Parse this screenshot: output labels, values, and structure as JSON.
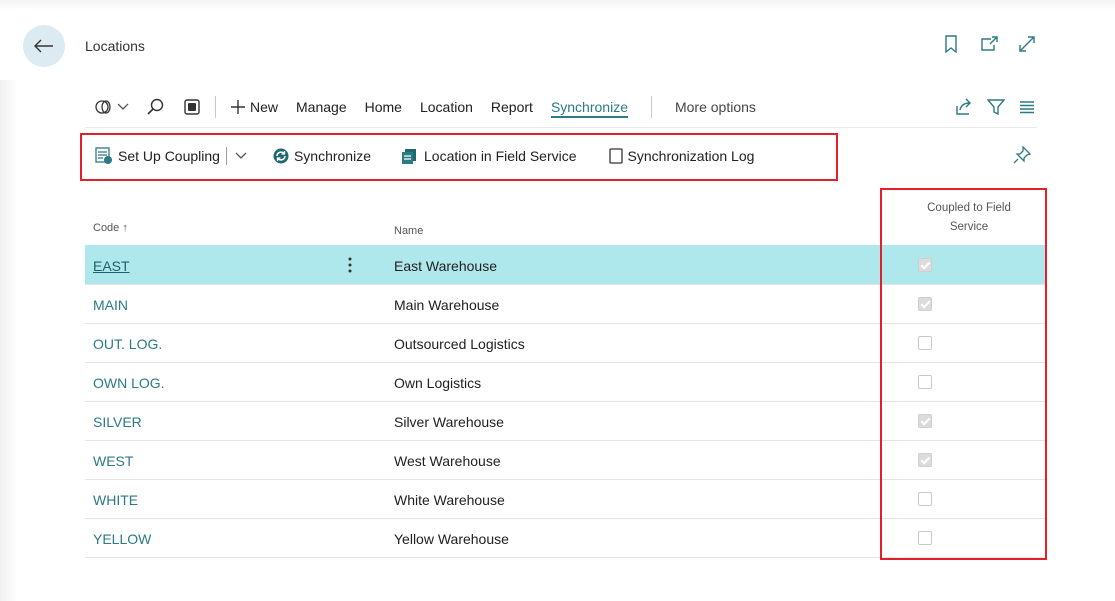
{
  "page": {
    "title": "Locations"
  },
  "action_bar": {
    "new_label": "New",
    "items": [
      "Manage",
      "Home",
      "Location",
      "Report",
      "Synchronize"
    ],
    "active_item": "Synchronize",
    "more_options": "More options"
  },
  "sub_actions": {
    "set_up_coupling": "Set Up Coupling",
    "synchronize": "Synchronize",
    "location_in_field_service": "Location in Field Service",
    "synchronization_log": "Synchronization Log"
  },
  "grid": {
    "columns": {
      "code": "Code",
      "name": "Name",
      "coupled": "Coupled to Field Service"
    },
    "sort_indicator": "↑",
    "rows": [
      {
        "code": "EAST",
        "name": "East Warehouse",
        "coupled": true,
        "selected": true
      },
      {
        "code": "MAIN",
        "name": "Main Warehouse",
        "coupled": true
      },
      {
        "code": "OUT. LOG.",
        "name": "Outsourced Logistics",
        "coupled": false
      },
      {
        "code": "OWN LOG.",
        "name": "Own Logistics",
        "coupled": false
      },
      {
        "code": "SILVER",
        "name": "Silver Warehouse",
        "coupled": true
      },
      {
        "code": "WEST",
        "name": "West Warehouse",
        "coupled": true
      },
      {
        "code": "WHITE",
        "name": "White Warehouse",
        "coupled": false
      },
      {
        "code": "YELLOW",
        "name": "Yellow Warehouse",
        "coupled": false
      }
    ]
  },
  "colors": {
    "accent": "#2c7a84",
    "selected_row": "#aee7ec",
    "highlight_box": "#e0202b",
    "back_button": "#dceaf1"
  },
  "icons": [
    "back-arrow-icon",
    "bookmark-icon",
    "open-new-window-icon",
    "expand-icon",
    "dataverse-icon",
    "search-icon",
    "edit-list-icon",
    "plus-icon",
    "share-icon",
    "filter-icon",
    "list-view-icon",
    "coupling-icon",
    "sync-icon",
    "field-service-icon",
    "log-icon",
    "pin-icon"
  ]
}
